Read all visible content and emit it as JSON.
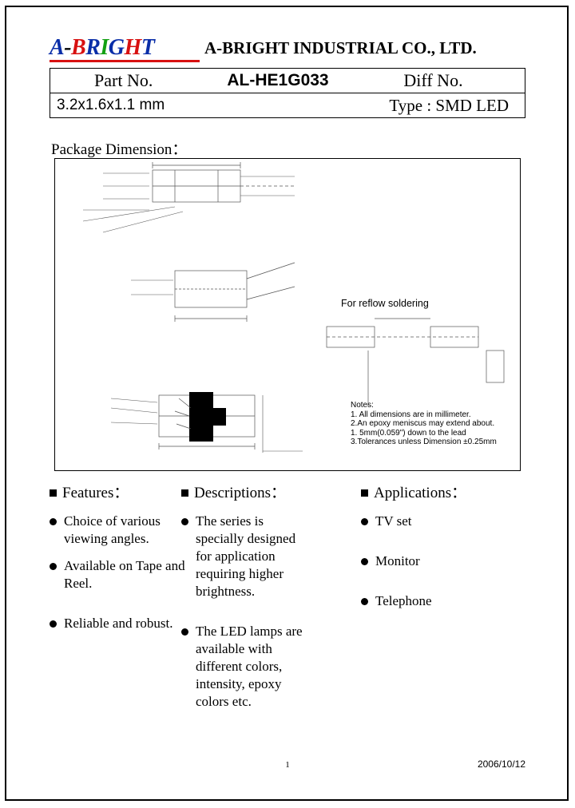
{
  "header": {
    "logo_text": "A-BRIGHT",
    "company_name": "A-BRIGHT INDUSTRIAL CO., LTD."
  },
  "part_table": {
    "part_no_label": "Part No.",
    "part_no_value": "AL-HE1G033",
    "diff_no_label": "Diff No.",
    "dimension": "3.2x1.6x1.1 mm",
    "type": "Type : SMD LED"
  },
  "package_dimension": {
    "title": "Package Dimension：",
    "reflow_label": "For reflow soldering",
    "notes": [
      "Notes:",
      "1. All dimensions are in millimeter.",
      "2.An epoxy meniscus may extend about.",
      "   1. 5mm(0.059\") down to the lead",
      "3.Tolerances unless Dimension ±0.25mm"
    ]
  },
  "columns": {
    "features": {
      "heading": "Features：",
      "items": [
        "Choice of various viewing angles.",
        "Available on Tape and Reel.",
        "Reliable and robust."
      ]
    },
    "descriptions": {
      "heading": "Descriptions：",
      "items": [
        "The series is specially designed for application requiring higher brightness.",
        "The LED lamps are available with different colors, intensity, epoxy colors etc."
      ]
    },
    "applications": {
      "heading": "Applications：",
      "items": [
        "TV set",
        "Monitor",
        "Telephone"
      ]
    }
  },
  "footer": {
    "page_number": "1",
    "date": "2006/10/12"
  }
}
